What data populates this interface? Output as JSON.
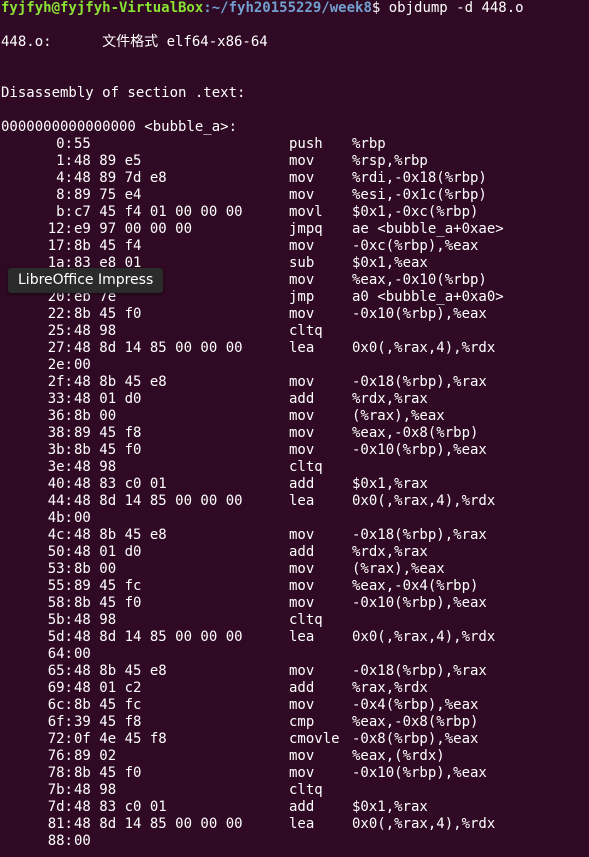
{
  "prompt": {
    "user_host": "fyjfyh@fyjfyh-VirtualBox",
    "path": ":~/fyh20155229/week8",
    "command": "$ objdump -d 448.o"
  },
  "file_format_line": "448.o:      文件格式 elf64-x86-64",
  "section_title": "Disassembly of section .text:",
  "function_header": "0000000000000000 <bubble_a>:",
  "instructions": [
    {
      "addr": "0:",
      "bytes": "55",
      "mnem": "push",
      "ops": "%rbp"
    },
    {
      "addr": "1:",
      "bytes": "48 89 e5",
      "mnem": "mov",
      "ops": "%rsp,%rbp"
    },
    {
      "addr": "4:",
      "bytes": "48 89 7d e8",
      "mnem": "mov",
      "ops": "%rdi,-0x18(%rbp)"
    },
    {
      "addr": "8:",
      "bytes": "89 75 e4",
      "mnem": "mov",
      "ops": "%esi,-0x1c(%rbp)"
    },
    {
      "addr": "b:",
      "bytes": "c7 45 f4 01 00 00 00",
      "mnem": "movl",
      "ops": "$0x1,-0xc(%rbp)"
    },
    {
      "addr": "12:",
      "bytes": "e9 97 00 00 00",
      "mnem": "jmpq",
      "ops": "ae <bubble_a+0xae>"
    },
    {
      "addr": "17:",
      "bytes": "8b 45 f4",
      "mnem": "mov",
      "ops": "-0xc(%rbp),%eax"
    },
    {
      "addr": "1a:",
      "bytes": "83 e8 01",
      "mnem": "sub",
      "ops": "$0x1,%eax"
    },
    {
      "addr": "",
      "bytes": "",
      "mnem": "mov",
      "ops": "%eax,-0x10(%rbp)"
    },
    {
      "addr": "20:",
      "bytes": "eb 7e",
      "mnem": "jmp",
      "ops": "a0 <bubble_a+0xa0>"
    },
    {
      "addr": "22:",
      "bytes": "8b 45 f0",
      "mnem": "mov",
      "ops": "-0x10(%rbp),%eax"
    },
    {
      "addr": "25:",
      "bytes": "48 98",
      "mnem": "cltq",
      "ops": ""
    },
    {
      "addr": "27:",
      "bytes": "48 8d 14 85 00 00 00",
      "mnem": "lea",
      "ops": "0x0(,%rax,4),%rdx"
    },
    {
      "addr": "2e:",
      "bytes": "00",
      "mnem": "",
      "ops": ""
    },
    {
      "addr": "2f:",
      "bytes": "48 8b 45 e8",
      "mnem": "mov",
      "ops": "-0x18(%rbp),%rax"
    },
    {
      "addr": "33:",
      "bytes": "48 01 d0",
      "mnem": "add",
      "ops": "%rdx,%rax"
    },
    {
      "addr": "36:",
      "bytes": "8b 00",
      "mnem": "mov",
      "ops": "(%rax),%eax"
    },
    {
      "addr": "38:",
      "bytes": "89 45 f8",
      "mnem": "mov",
      "ops": "%eax,-0x8(%rbp)"
    },
    {
      "addr": "3b:",
      "bytes": "8b 45 f0",
      "mnem": "mov",
      "ops": "-0x10(%rbp),%eax"
    },
    {
      "addr": "3e:",
      "bytes": "48 98",
      "mnem": "cltq",
      "ops": ""
    },
    {
      "addr": "40:",
      "bytes": "48 83 c0 01",
      "mnem": "add",
      "ops": "$0x1,%rax"
    },
    {
      "addr": "44:",
      "bytes": "48 8d 14 85 00 00 00",
      "mnem": "lea",
      "ops": "0x0(,%rax,4),%rdx"
    },
    {
      "addr": "4b:",
      "bytes": "00",
      "mnem": "",
      "ops": ""
    },
    {
      "addr": "4c:",
      "bytes": "48 8b 45 e8",
      "mnem": "mov",
      "ops": "-0x18(%rbp),%rax"
    },
    {
      "addr": "50:",
      "bytes": "48 01 d0",
      "mnem": "add",
      "ops": "%rdx,%rax"
    },
    {
      "addr": "53:",
      "bytes": "8b 00",
      "mnem": "mov",
      "ops": "(%rax),%eax"
    },
    {
      "addr": "55:",
      "bytes": "89 45 fc",
      "mnem": "mov",
      "ops": "%eax,-0x4(%rbp)"
    },
    {
      "addr": "58:",
      "bytes": "8b 45 f0",
      "mnem": "mov",
      "ops": "-0x10(%rbp),%eax"
    },
    {
      "addr": "5b:",
      "bytes": "48 98",
      "mnem": "cltq",
      "ops": ""
    },
    {
      "addr": "5d:",
      "bytes": "48 8d 14 85 00 00 00",
      "mnem": "lea",
      "ops": "0x0(,%rax,4),%rdx"
    },
    {
      "addr": "64:",
      "bytes": "00",
      "mnem": "",
      "ops": ""
    },
    {
      "addr": "65:",
      "bytes": "48 8b 45 e8",
      "mnem": "mov",
      "ops": "-0x18(%rbp),%rax"
    },
    {
      "addr": "69:",
      "bytes": "48 01 c2",
      "mnem": "add",
      "ops": "%rax,%rdx"
    },
    {
      "addr": "6c:",
      "bytes": "8b 45 fc",
      "mnem": "mov",
      "ops": "-0x4(%rbp),%eax"
    },
    {
      "addr": "6f:",
      "bytes": "39 45 f8",
      "mnem": "cmp",
      "ops": "%eax,-0x8(%rbp)"
    },
    {
      "addr": "72:",
      "bytes": "0f 4e 45 f8",
      "mnem": "cmovle",
      "ops": "-0x8(%rbp),%eax"
    },
    {
      "addr": "76:",
      "bytes": "89 02",
      "mnem": "mov",
      "ops": "%eax,(%rdx)"
    },
    {
      "addr": "78:",
      "bytes": "8b 45 f0",
      "mnem": "mov",
      "ops": "-0x10(%rbp),%eax"
    },
    {
      "addr": "7b:",
      "bytes": "48 98",
      "mnem": "cltq",
      "ops": ""
    },
    {
      "addr": "7d:",
      "bytes": "48 83 c0 01",
      "mnem": "add",
      "ops": "$0x1,%rax"
    },
    {
      "addr": "81:",
      "bytes": "48 8d 14 85 00 00 00",
      "mnem": "lea",
      "ops": "0x0(,%rax,4),%rdx"
    },
    {
      "addr": "88:",
      "bytes": "00",
      "mnem": "",
      "ops": ""
    }
  ],
  "tooltip": "LibreOffice Impress",
  "colors": {
    "background": "#300a24",
    "prompt_user": "#8ae234",
    "prompt_path": "#729fcf",
    "text": "#ffffff"
  }
}
